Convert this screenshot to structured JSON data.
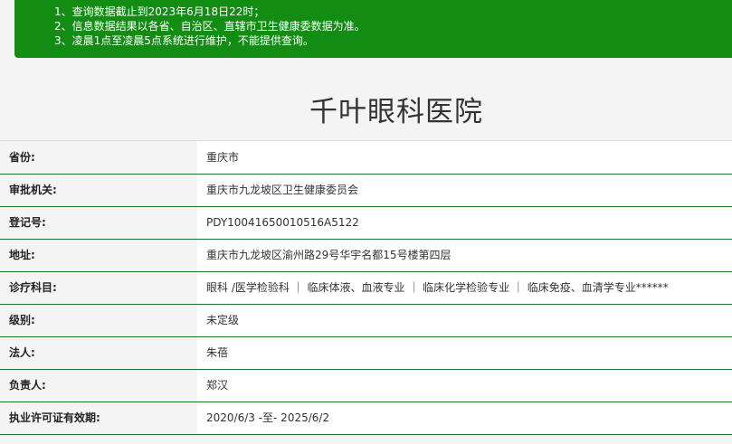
{
  "notice": {
    "line1": "1、查询数据截止到2023年6月18日22时；",
    "line2": "2、信息数据结果以各省、自治区、直辖市卫生健康委数据为准。",
    "line3": "3、凌晨1点至凌晨5点系统进行维护，不能提供查询。"
  },
  "hospital_name": "千叶眼科医院",
  "rows": [
    {
      "label": "省份:",
      "value": "重庆市"
    },
    {
      "label": "审批机关:",
      "value": "重庆市九龙坡区卫生健康委员会"
    },
    {
      "label": "登记号:",
      "value": "PDY10041650010516A5122"
    },
    {
      "label": "地址:",
      "value": "重庆市九龙坡区渝州路29号华宇名都15号楼第四层"
    },
    {
      "label": "诊疗科目:",
      "value": "眼科 /医学检验科 ｜ 临床体液、血液专业 ｜ 临床化学检验专业 ｜ 临床免疫、血清学专业******"
    },
    {
      "label": "级别:",
      "value": "未定级"
    },
    {
      "label": "法人:",
      "value": "朱蓓"
    },
    {
      "label": "负责人:",
      "value": "郑汉"
    },
    {
      "label": "执业许可证有效期:",
      "value": "2020/6/3 -至- 2025/6/2"
    }
  ]
}
